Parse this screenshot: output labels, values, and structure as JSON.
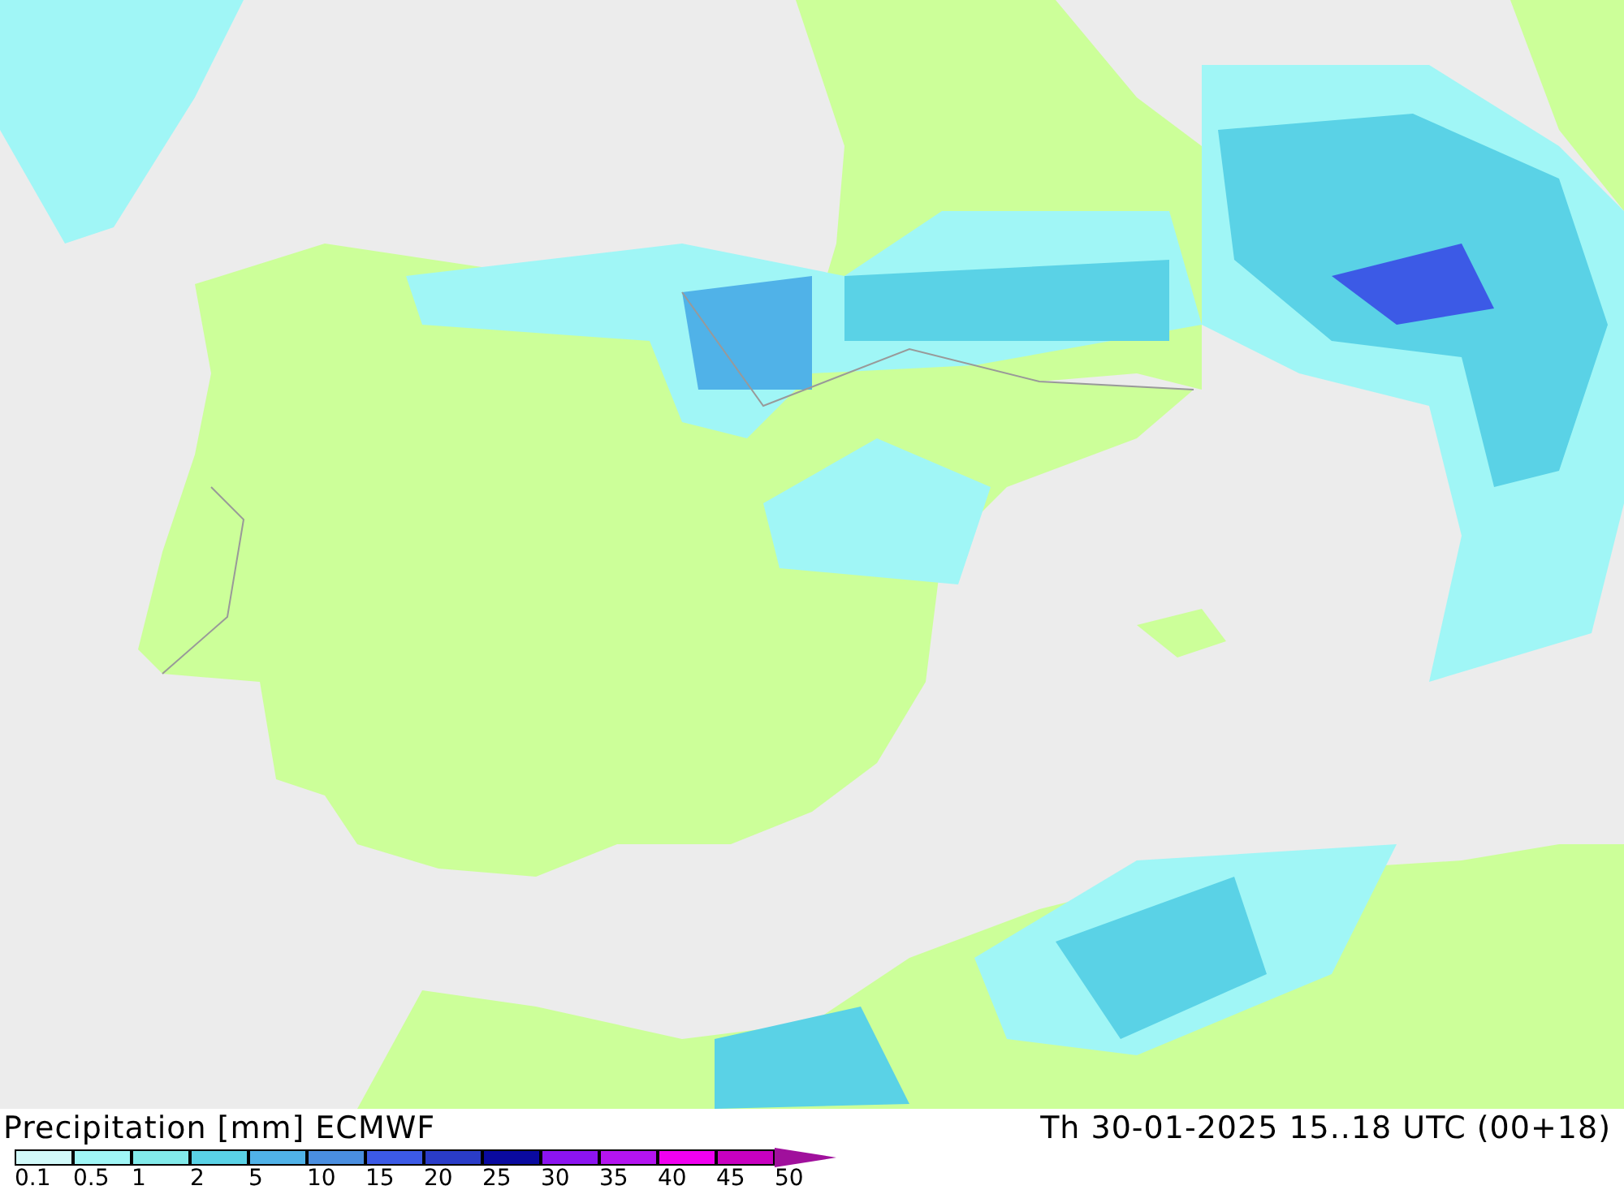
{
  "title": "Precipitation [mm] ECMWF",
  "valid_time": "Th 30-01-2025 15..18 UTC (00+18)",
  "legend": [
    {
      "label": "0.1",
      "color": "#d2fafa"
    },
    {
      "label": "0.5",
      "color": "#a0f6f6"
    },
    {
      "label": "1",
      "color": "#82eaea"
    },
    {
      "label": "2",
      "color": "#5ad2e6"
    },
    {
      "label": "5",
      "color": "#50b2e8"
    },
    {
      "label": "10",
      "color": "#4a8ee0"
    },
    {
      "label": "15",
      "color": "#3c5ae6"
    },
    {
      "label": "20",
      "color": "#2a3cc8"
    },
    {
      "label": "25",
      "color": "#0a0aa0"
    },
    {
      "label": "30",
      "color": "#8c14f0"
    },
    {
      "label": "35",
      "color": "#b414f0"
    },
    {
      "label": "40",
      "color": "#f000f0"
    },
    {
      "label": "45",
      "color": "#c800c0"
    },
    {
      "label": "50",
      "color": "#a0109c"
    }
  ]
}
